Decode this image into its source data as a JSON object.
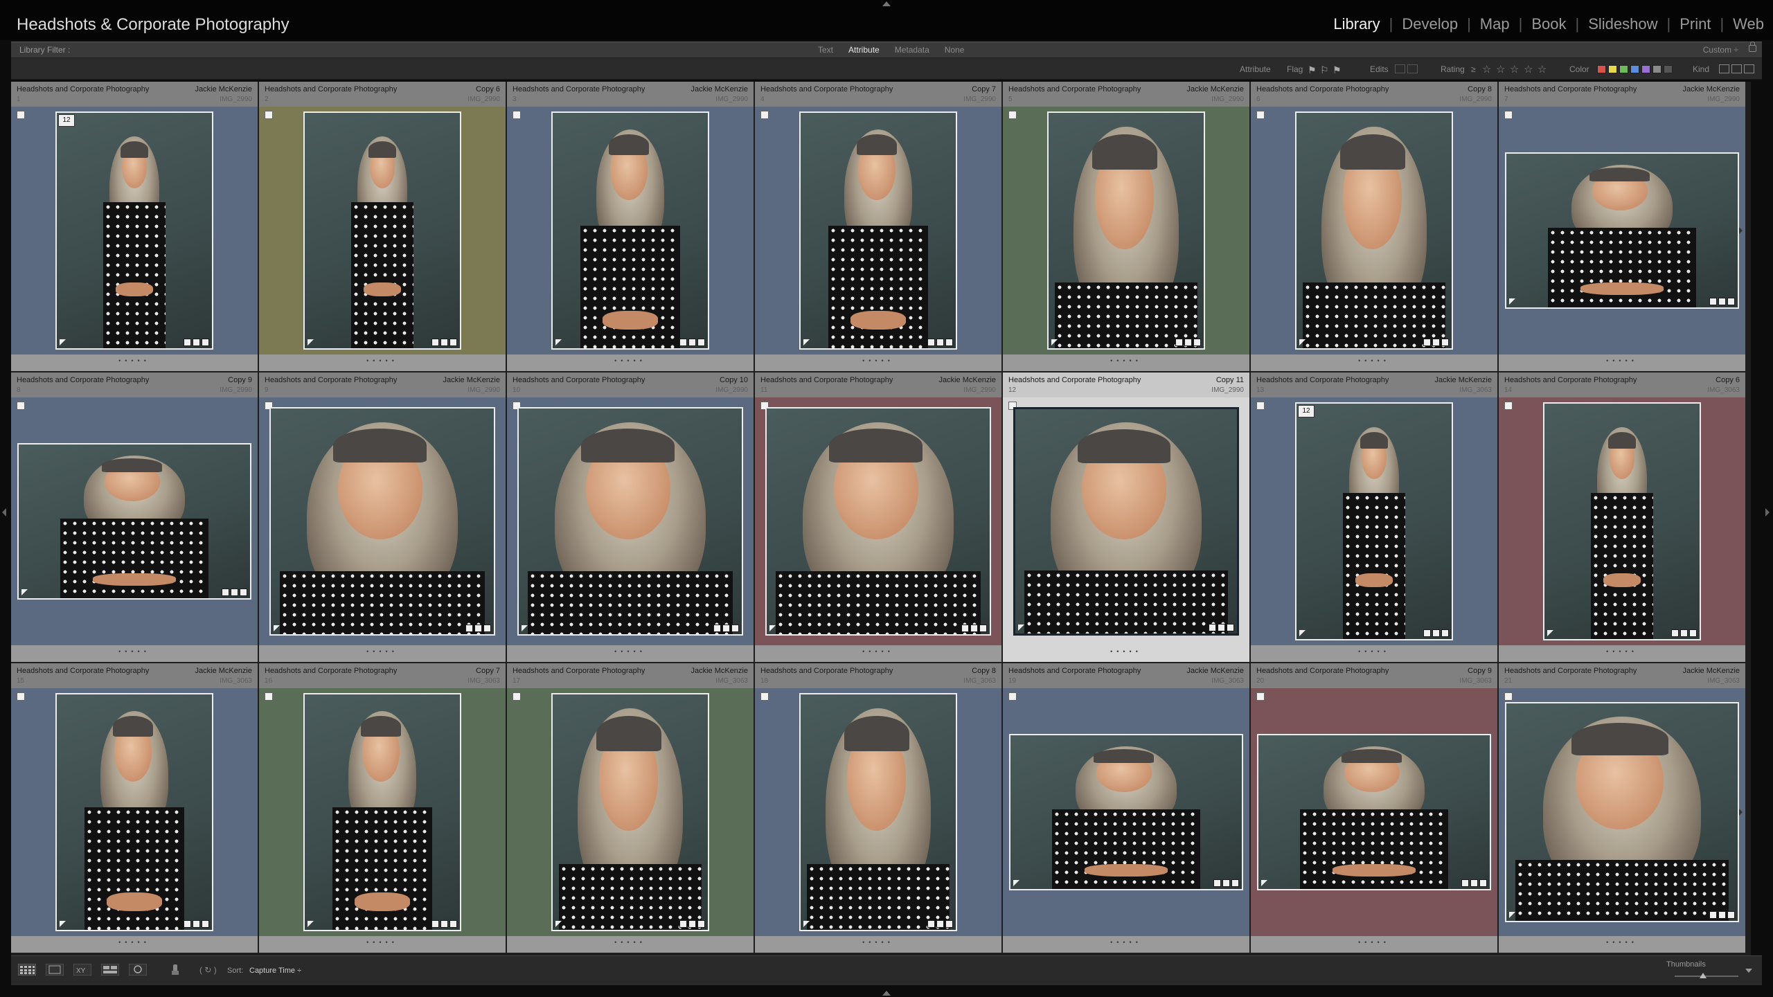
{
  "app_title": "Headshots & Corporate Photography",
  "modules": [
    "Library",
    "Develop",
    "Map",
    "Book",
    "Slideshow",
    "Print",
    "Web"
  ],
  "active_module": "Library",
  "filter_bar": {
    "label": "Library Filter :",
    "tabs": [
      "Text",
      "Attribute",
      "Metadata",
      "None"
    ],
    "active_tab": "Attribute",
    "preset": "Custom ÷"
  },
  "attribute_bar": {
    "attribute_label": "Attribute",
    "flag_label": "Flag",
    "edits_label": "Edits",
    "rating_label": "Rating",
    "rating_op": "≥",
    "color_label": "Color",
    "kind_label": "Kind",
    "color_swatches": [
      "#d9534a",
      "#e8d84a",
      "#6dbb5a",
      "#5b8ee0",
      "#9a6fd6",
      "#8a8a8a",
      "#555555"
    ]
  },
  "colors": {
    "blue_label": "#5c6a81",
    "yellow_label": "#7b7a52",
    "green_label": "#5a6d56",
    "red_label": "#7a5458",
    "selected": "#d6d6d6"
  },
  "cells": [
    {
      "title": "Headshots and Corporate Photography",
      "meta": "Jackie McKenzie",
      "num": "1",
      "file": "IMG_2990",
      "label": "blue_label",
      "orient": "portrait",
      "pose": "full",
      "stack": "12"
    },
    {
      "title": "Headshots and Corporate Photography",
      "meta": "Copy 6",
      "num": "2",
      "file": "IMG_2990",
      "label": "yellow_label",
      "orient": "portrait",
      "pose": "full"
    },
    {
      "title": "Headshots and Corporate Photography",
      "meta": "Jackie McKenzie",
      "num": "3",
      "file": "IMG_2990",
      "label": "blue_label",
      "orient": "portrait",
      "pose": "half"
    },
    {
      "title": "Headshots and Corporate Photography",
      "meta": "Copy 7",
      "num": "4",
      "file": "IMG_2990",
      "label": "blue_label",
      "orient": "portrait",
      "pose": "half"
    },
    {
      "title": "Headshots and Corporate Photography",
      "meta": "Jackie McKenzie",
      "num": "5",
      "file": "IMG_2990",
      "label": "green_label",
      "orient": "portrait",
      "pose": "close"
    },
    {
      "title": "Headshots and Corporate Photography",
      "meta": "Copy 8",
      "num": "6",
      "file": "IMG_2990",
      "label": "blue_label",
      "orient": "portrait",
      "pose": "close"
    },
    {
      "title": "Headshots and Corporate Photography",
      "meta": "Jackie McKenzie",
      "num": "7",
      "file": "IMG_2990",
      "label": "blue_label",
      "orient": "landscape",
      "pose": "half"
    },
    {
      "title": "Headshots and Corporate Photography",
      "meta": "Copy 9",
      "num": "8",
      "file": "IMG_2990",
      "label": "blue_label",
      "orient": "landscape",
      "pose": "half"
    },
    {
      "title": "Headshots and Corporate Photography",
      "meta": "Jackie McKenzie",
      "num": "9",
      "file": "IMG_2990",
      "label": "blue_label",
      "orient": "square",
      "pose": "close"
    },
    {
      "title": "Headshots and Corporate Photography",
      "meta": "Copy 10",
      "num": "10",
      "file": "IMG_2990",
      "label": "blue_label",
      "orient": "square",
      "pose": "close"
    },
    {
      "title": "Headshots and Corporate Photography",
      "meta": "Jackie McKenzie",
      "num": "11",
      "file": "IMG_2990",
      "label": "red_label",
      "orient": "square",
      "pose": "close"
    },
    {
      "title": "Headshots and Corporate Photography",
      "meta": "Copy 11",
      "num": "12",
      "file": "IMG_2990",
      "label": "selected",
      "orient": "square",
      "pose": "close",
      "selected": true
    },
    {
      "title": "Headshots and Corporate Photography",
      "meta": "Jackie McKenzie",
      "num": "13",
      "file": "IMG_3063",
      "label": "blue_label",
      "orient": "portrait",
      "pose": "full",
      "stack": "12"
    },
    {
      "title": "Headshots and Corporate Photography",
      "meta": "Copy 6",
      "num": "14",
      "file": "IMG_3063",
      "label": "red_label",
      "orient": "portrait",
      "pose": "full"
    },
    {
      "title": "Headshots and Corporate Photography",
      "meta": "Jackie McKenzie",
      "num": "15",
      "file": "IMG_3063",
      "label": "blue_label",
      "orient": "portrait",
      "pose": "half"
    },
    {
      "title": "Headshots and Corporate Photography",
      "meta": "Copy 7",
      "num": "16",
      "file": "IMG_3063",
      "label": "green_label",
      "orient": "portrait",
      "pose": "half"
    },
    {
      "title": "Headshots and Corporate Photography",
      "meta": "Jackie McKenzie",
      "num": "17",
      "file": "IMG_3063",
      "label": "green_label",
      "orient": "portrait",
      "pose": "close"
    },
    {
      "title": "Headshots and Corporate Photography",
      "meta": "Copy 8",
      "num": "18",
      "file": "IMG_3063",
      "label": "blue_label",
      "orient": "portrait",
      "pose": "close"
    },
    {
      "title": "Headshots and Corporate Photography",
      "meta": "Jackie McKenzie",
      "num": "19",
      "file": "IMG_3063",
      "label": "blue_label",
      "orient": "landscape",
      "pose": "half"
    },
    {
      "title": "Headshots and Corporate Photography",
      "meta": "Copy 9",
      "num": "20",
      "file": "IMG_3063",
      "label": "red_label",
      "orient": "landscape",
      "pose": "half"
    },
    {
      "title": "Headshots and Corporate Photography",
      "meta": "Jackie McKenzie",
      "num": "21",
      "file": "IMG_3063",
      "label": "blue_label",
      "orient": "portrait-wide",
      "pose": "close"
    }
  ],
  "toolbar": {
    "sort_label": "Sort:",
    "sort_value": "Capture Time ÷",
    "thumbnails_label": "Thumbnails",
    "thumbnail_size": 0.45
  }
}
